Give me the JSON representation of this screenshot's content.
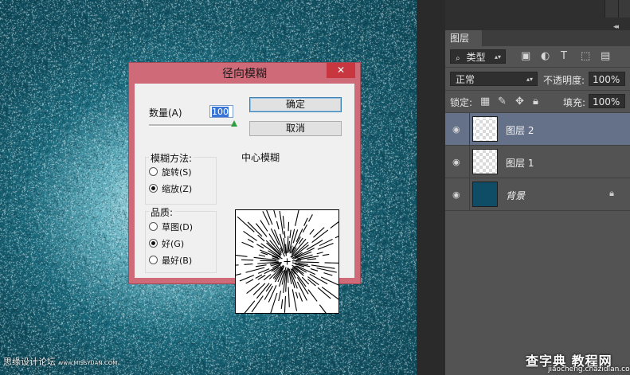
{
  "dialog": {
    "title": "径向模糊",
    "close_label": "✕",
    "amount_label": "数量(A)",
    "amount_value": "100",
    "amount_fraction": 1.0,
    "ok_label": "确定",
    "cancel_label": "取消",
    "method": {
      "legend": "模糊方法:",
      "options": [
        {
          "label": "旋转(S)",
          "selected": false
        },
        {
          "label": "缩放(Z)",
          "selected": true
        }
      ]
    },
    "quality": {
      "legend": "品质:",
      "options": [
        {
          "label": "草图(D)",
          "selected": false
        },
        {
          "label": "好(G)",
          "selected": true
        },
        {
          "label": "最好(B)",
          "selected": false
        }
      ]
    },
    "center_label": "中心模糊"
  },
  "layers_panel": {
    "tab_label": "图层",
    "filter_label": "类型",
    "blend_mode": "正常",
    "opacity_label": "不透明度:",
    "opacity_value": "100%",
    "lock_label": "锁定:",
    "fill_label": "填充:",
    "fill_value": "100%",
    "layers": [
      {
        "name": "图层 2",
        "selected": true,
        "thumb": "transparent",
        "locked": false
      },
      {
        "name": "图层 1",
        "selected": false,
        "thumb": "transparent",
        "locked": false
      },
      {
        "name": "背景",
        "selected": false,
        "thumb": "solid",
        "locked": true
      }
    ]
  },
  "watermarks": {
    "left": "思缘设计论坛",
    "left_url": "www.MISSYUAN.COM",
    "right_big": "查字典 教程网",
    "right_small": "jiaocheng.chazidian.com"
  },
  "colors": {
    "dialog_border": "#cf6a78",
    "close_button": "#c8373f",
    "selected_layer": "#647188",
    "background_layer": "#0f4c66"
  }
}
